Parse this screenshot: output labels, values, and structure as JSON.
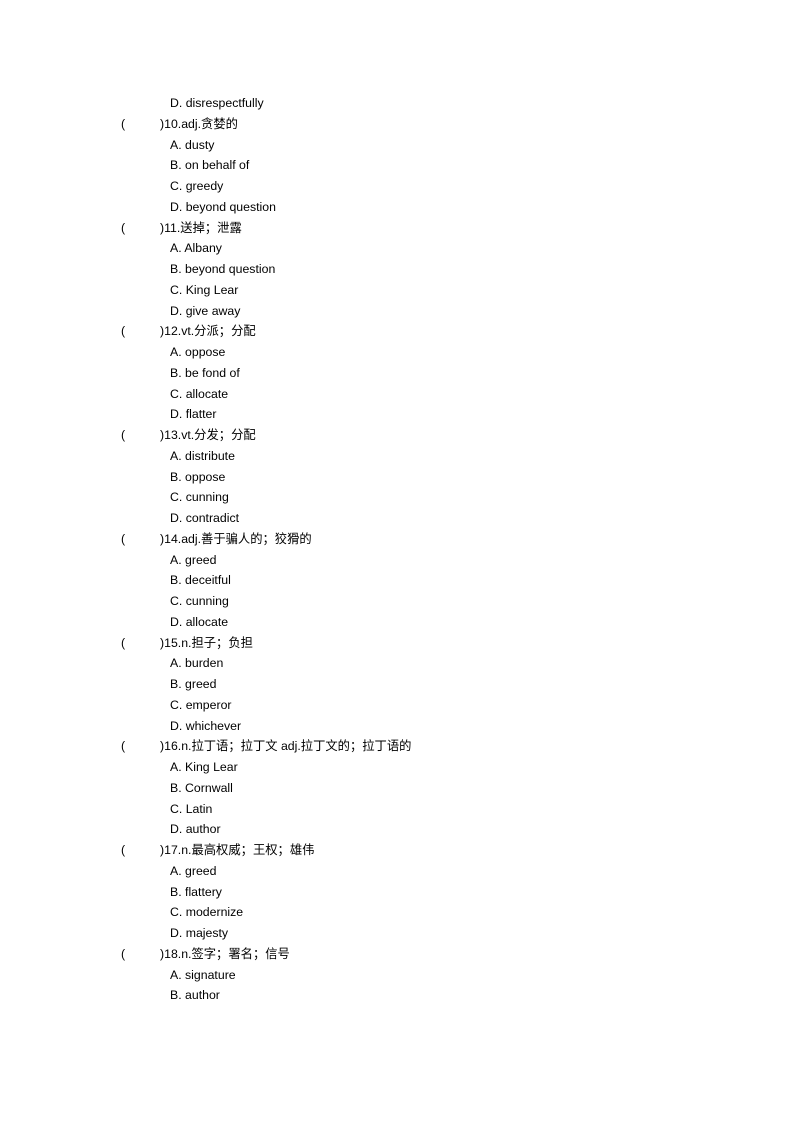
{
  "document": {
    "page_background": "#ffffff",
    "text_color": "#000000",
    "continued_option": {
      "label": "D.",
      "text": "disrespectfully",
      "full": "D. disrespectfully"
    },
    "marker_open": "(",
    "marker_close": ")"
  },
  "questions": [
    {
      "number": "10.",
      "pos": "adj.",
      "prompt": "贪婪的",
      "stem": "10.adj.贪婪的",
      "options": [
        {
          "label": "A.",
          "text": "dusty",
          "full": "A. dusty"
        },
        {
          "label": "B.",
          "text": "on behalf of",
          "full": "B. on behalf of"
        },
        {
          "label": "C.",
          "text": "greedy",
          "full": "C. greedy"
        },
        {
          "label": "D.",
          "text": "beyond question",
          "full": "D. beyond question"
        }
      ]
    },
    {
      "number": "11.",
      "pos": "",
      "prompt": "送掉；泄露",
      "stem": "11.送掉；泄露",
      "options": [
        {
          "label": "A.",
          "text": "Albany",
          "full": "A. Albany"
        },
        {
          "label": "B.",
          "text": "beyond question",
          "full": "B. beyond question"
        },
        {
          "label": "C.",
          "text": "King Lear",
          "full": "C. King Lear"
        },
        {
          "label": "D.",
          "text": "give away",
          "full": "D. give away"
        }
      ]
    },
    {
      "number": "12.",
      "pos": "vt.",
      "prompt": "分派；分配",
      "stem": "12.vt.分派；分配",
      "options": [
        {
          "label": "A.",
          "text": "oppose",
          "full": "A. oppose"
        },
        {
          "label": "B.",
          "text": "be fond of",
          "full": "B. be fond of"
        },
        {
          "label": "C.",
          "text": "allocate",
          "full": "C. allocate"
        },
        {
          "label": "D.",
          "text": "flatter",
          "full": "D. flatter"
        }
      ]
    },
    {
      "number": "13.",
      "pos": "vt.",
      "prompt": "分发；分配",
      "stem": "13.vt.分发；分配",
      "options": [
        {
          "label": "A.",
          "text": "distribute",
          "full": "A. distribute"
        },
        {
          "label": "B.",
          "text": "oppose",
          "full": "B. oppose"
        },
        {
          "label": "C.",
          "text": "cunning",
          "full": "C. cunning"
        },
        {
          "label": "D.",
          "text": "contradict",
          "full": "D. contradict"
        }
      ]
    },
    {
      "number": "14.",
      "pos": "adj.",
      "prompt": "善于骗人的；狡猾的",
      "stem": "14.adj.善于骗人的；狡猾的",
      "options": [
        {
          "label": "A.",
          "text": "greed",
          "full": "A. greed"
        },
        {
          "label": "B.",
          "text": "deceitful",
          "full": "B. deceitful"
        },
        {
          "label": "C.",
          "text": "cunning",
          "full": "C. cunning"
        },
        {
          "label": "D.",
          "text": "allocate",
          "full": "D. allocate"
        }
      ]
    },
    {
      "number": "15.",
      "pos": "n.",
      "prompt": "担子；负担",
      "stem": "15.n.担子；负担",
      "options": [
        {
          "label": "A.",
          "text": "burden",
          "full": "A. burden"
        },
        {
          "label": "B.",
          "text": "greed",
          "full": "B. greed"
        },
        {
          "label": "C.",
          "text": "emperor",
          "full": "C. emperor"
        },
        {
          "label": "D.",
          "text": "whichever",
          "full": "D. whichever"
        }
      ]
    },
    {
      "number": "16.",
      "pos": "n.",
      "prompt": "拉丁语；拉丁文  adj.拉丁文的；拉丁语的",
      "stem": "16.n.拉丁语；拉丁文  adj.拉丁文的；拉丁语的",
      "options": [
        {
          "label": "A.",
          "text": "King Lear",
          "full": "A. King Lear"
        },
        {
          "label": "B.",
          "text": "Cornwall",
          "full": "B. Cornwall"
        },
        {
          "label": "C.",
          "text": "Latin",
          "full": "C. Latin"
        },
        {
          "label": "D.",
          "text": "author",
          "full": "D. author"
        }
      ]
    },
    {
      "number": "17.",
      "pos": "n.",
      "prompt": "最高权威；王权；雄伟",
      "stem": "17.n.最高权威；王权；雄伟",
      "options": [
        {
          "label": "A.",
          "text": "greed",
          "full": "A. greed"
        },
        {
          "label": "B.",
          "text": "flattery",
          "full": "B. flattery"
        },
        {
          "label": "C.",
          "text": "modernize",
          "full": "C. modernize"
        },
        {
          "label": "D.",
          "text": "majesty",
          "full": "D. majesty"
        }
      ]
    },
    {
      "number": "18.",
      "pos": "n.",
      "prompt": "签字；署名；信号",
      "stem": "18.n.签字；署名；信号",
      "options": [
        {
          "label": "A.",
          "text": "signature",
          "full": "A. signature"
        },
        {
          "label": "B.",
          "text": "author",
          "full": "B. author"
        }
      ]
    }
  ]
}
